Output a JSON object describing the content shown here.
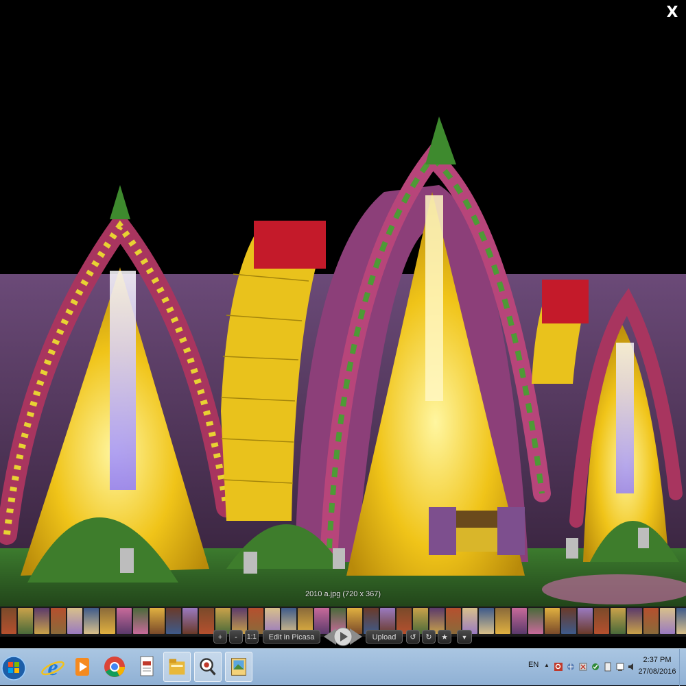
{
  "viewer": {
    "close_label": "X",
    "caption": "2010 a.jpg (720 x 367)",
    "photo_description": "Illuminated wedding stage with yellow drapes, floral arches and a seat"
  },
  "toolbar": {
    "zoom_in": "+",
    "zoom_out": "-",
    "actual_size": "1:1",
    "edit": "Edit in Picasa",
    "upload": "Upload",
    "rotate_left": "↺",
    "rotate_right": "↻",
    "star": "★",
    "more": "▼"
  },
  "taskbar": {
    "language": "EN",
    "time": "2:37 PM",
    "date": "27/08/2016",
    "tray_arrow": "▲"
  },
  "colors": {
    "background": "#000000",
    "taskbar": "#9dbcdd",
    "drape_yellow": "#f2c21a",
    "arch_purple": "#8c3f79"
  }
}
